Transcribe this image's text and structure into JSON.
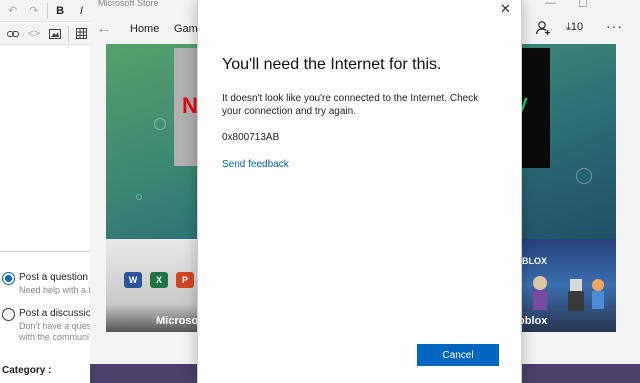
{
  "editor": {
    "options": [
      {
        "label": "Post a question",
        "sub": [
          "Need help with a t"
        ]
      },
      {
        "label": "Post a discussion",
        "sub": [
          "Don't have a quest",
          "with the communi"
        ]
      }
    ],
    "category_label": "Category :"
  },
  "store": {
    "window_title": "Microsoft Store",
    "nav": {
      "home": "Home",
      "gaming": "Gami"
    },
    "downloads": "10",
    "more": "···",
    "window_controls": [
      "—",
      "☐"
    ],
    "hero": {
      "netflix_text": "N",
      "spotify_text": "fy"
    },
    "tiles": {
      "office_label": "Microsoft",
      "roblox_label": "oblox",
      "roblox_logo": "BLOX"
    },
    "office_icons": [
      "W",
      "X",
      "P"
    ]
  },
  "dialog": {
    "close": "✕",
    "title": "You'll need the Internet for this.",
    "message": "It doesn't look like you're connected to the Internet. Check your connection and try again.",
    "error_code": "0x800713AB",
    "feedback_link": "Send feedback",
    "cancel_label": "Cancel"
  },
  "colors": {
    "accent": "#0067c0",
    "hero_top": "#58a06b",
    "hero_bottom": "#1f4f66"
  }
}
